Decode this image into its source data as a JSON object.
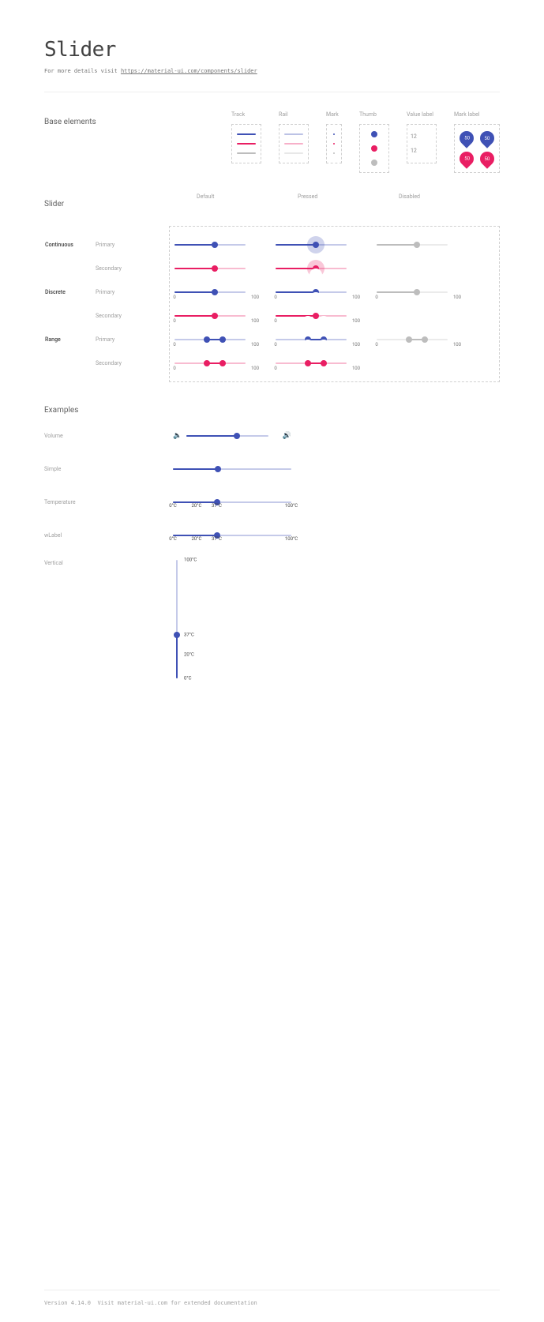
{
  "page": {
    "title": "Slider",
    "intro_prefix": "For more details visit ",
    "intro_link": "https://material-ui.com/components/slider"
  },
  "base": {
    "heading": "Base elements",
    "cols": {
      "track": "Track",
      "rail": "Rail",
      "mark": "Mark",
      "thumb": "Thumb",
      "value_label": "Value label",
      "mark_label": "Mark label"
    },
    "value_label_samples": [
      "12",
      "12"
    ],
    "mark_label_samples": [
      "50",
      "50",
      "50",
      "50"
    ]
  },
  "matrix": {
    "heading": "Slider",
    "state_headers": [
      "Default",
      "Pressed",
      "Disabled"
    ],
    "cats": {
      "continuous": "Continuous",
      "discrete": "Discrete",
      "range": "Range"
    },
    "vars": {
      "primary": "Primary",
      "secondary": "Secondary"
    },
    "axis": {
      "min": "0",
      "max": "100"
    },
    "pressed_value": "50",
    "range_values": [
      "40",
      "60"
    ]
  },
  "examples": {
    "heading": "Examples",
    "rows": {
      "volume": "Volume",
      "simple": "Simple",
      "temperature": "Temperature",
      "wlabel": "wLabel",
      "vertical": "Vertical"
    },
    "temp_marks": [
      "0°C",
      "20°C",
      "37°C",
      "100°C"
    ],
    "wlabel_value": "37",
    "vert_marks": [
      "0°C",
      "20°C",
      "37°C",
      "100°C"
    ]
  },
  "footer": {
    "version": "Version 4.14.0",
    "note": "Visit material-ui.com for extended documentation"
  }
}
